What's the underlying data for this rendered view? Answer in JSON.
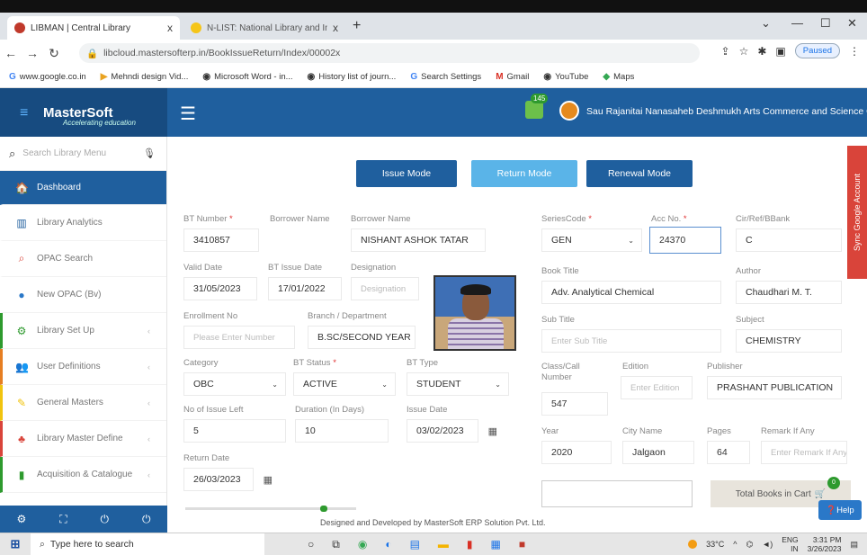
{
  "browser": {
    "tabs": [
      {
        "label": "LIBMAN | Central Library",
        "close": "x"
      },
      {
        "label": "N-LIST: National Library and Info",
        "close": "x"
      }
    ],
    "new_tab": "+",
    "window_controls": {
      "minimize": "—",
      "maximize": "☐",
      "close": "✕",
      "menu": "⌄"
    },
    "url": "libcloud.mastersofterp.in/BookIssueReturn/Index/00002x",
    "profile_status": "Paused",
    "bookmarks": [
      {
        "label": "www.google.co.in",
        "icon": "G"
      },
      {
        "label": "Mehndi design Vid...",
        "icon": "▶"
      },
      {
        "label": "Microsoft Word - in...",
        "icon": "◉"
      },
      {
        "label": "History list of journ...",
        "icon": "◉"
      },
      {
        "label": "Search Settings",
        "icon": "G"
      },
      {
        "label": "Gmail",
        "icon": "M"
      },
      {
        "label": "YouTube",
        "icon": "◉"
      },
      {
        "label": "Maps",
        "icon": "◆"
      }
    ]
  },
  "app": {
    "logo_name": "MasterSoft",
    "logo_tag": "Accelerating education",
    "notification_count": "145",
    "college_name": "Sau Rajanitai Nanasaheb Deshmukh Arts Commerce and Science College"
  },
  "sidebar": {
    "search_placeholder": "Search Library Menu",
    "items": [
      {
        "label": "Dashboard",
        "icon": "dashboard-icon"
      },
      {
        "label": "Library Analytics",
        "icon": "chart-icon"
      },
      {
        "label": "OPAC Search",
        "icon": "search-icon"
      },
      {
        "label": "New OPAC (Bv)",
        "icon": "globe-icon"
      },
      {
        "label": "Library Set Up",
        "icon": "gear-icon"
      },
      {
        "label": "User Definitions",
        "icon": "users-icon"
      },
      {
        "label": "General Masters",
        "icon": "edit-icon"
      },
      {
        "label": "Library Master Define",
        "icon": "people-icon"
      },
      {
        "label": "Acquisition & Catalogue",
        "icon": "book-icon"
      }
    ],
    "footer_icons": [
      "⚙",
      "⛶",
      "⏻",
      "⏻"
    ]
  },
  "modes": {
    "issue": "Issue Mode",
    "return": "Return Mode",
    "renewal": "Renewal Mode"
  },
  "form": {
    "bt_number": {
      "label": "BT Number",
      "value": "3410857"
    },
    "borrower_name_label1": "Borrower Name",
    "borrower_name": {
      "label": "Borrower Name",
      "value": "NISHANT ASHOK TATAR"
    },
    "valid_date": {
      "label": "Valid Date",
      "value": "31/05/2023"
    },
    "bt_issue_date": {
      "label": "BT Issue Date",
      "value": "17/01/2022"
    },
    "designation": {
      "label": "Designation",
      "placeholder": "Designation"
    },
    "enrollment_no": {
      "label": "Enrollment No",
      "placeholder": "Please Enter Number"
    },
    "branch": {
      "label": "Branch / Department",
      "value": "B.SC/SECOND YEAR"
    },
    "category": {
      "label": "Category",
      "value": "OBC"
    },
    "bt_status": {
      "label": "BT Status",
      "value": "ACTIVE"
    },
    "bt_type": {
      "label": "BT Type",
      "value": "STUDENT"
    },
    "issue_left": {
      "label": "No of Issue Left",
      "value": "5"
    },
    "duration": {
      "label": "Duration (In Days)",
      "value": "10"
    },
    "issue_date": {
      "label": "Issue Date",
      "value": "03/02/2023"
    },
    "return_date": {
      "label": "Return Date",
      "value": "26/03/2023"
    },
    "series_code": {
      "label": "SeriesCode",
      "value": "GEN"
    },
    "acc_no": {
      "label": "Acc No.",
      "value": "24370"
    },
    "cir_ref": {
      "label": "Cir/Ref/BBank",
      "value": "C"
    },
    "book_title": {
      "label": "Book Title",
      "value": "Adv. Analytical Chemical"
    },
    "author": {
      "label": "Author",
      "value": "Chaudhari M. T."
    },
    "sub_title": {
      "label": "Sub Title",
      "placeholder": "Enter Sub Title"
    },
    "subject": {
      "label": "Subject",
      "value": "CHEMISTRY"
    },
    "class_call": {
      "label": "Class/Call Number",
      "value": "547"
    },
    "edition": {
      "label": "Edition",
      "placeholder": "Enter Edition"
    },
    "publisher": {
      "label": "Publisher",
      "value": "PRASHANT PUBLICATION"
    },
    "year": {
      "label": "Year",
      "value": "2020"
    },
    "city": {
      "label": "City Name",
      "value": "Jalgaon"
    },
    "pages": {
      "label": "Pages",
      "value": "64"
    },
    "remark": {
      "label": "Remark If Any",
      "placeholder": "Enter Remark If Any"
    },
    "required_mark": "*"
  },
  "cart": {
    "label": "Total Books in Cart",
    "count": "0"
  },
  "sync_label": "Sync Google Account",
  "help_label": "Help",
  "footer_text": "Designed and Developed by MasterSoft ERP Solution Pvt. Ltd.",
  "taskbar": {
    "search_placeholder": "Type here to search",
    "temperature": "33°C",
    "lang": "ENG",
    "region": "IN",
    "time": "3:31 PM",
    "date": "3/26/2023"
  }
}
